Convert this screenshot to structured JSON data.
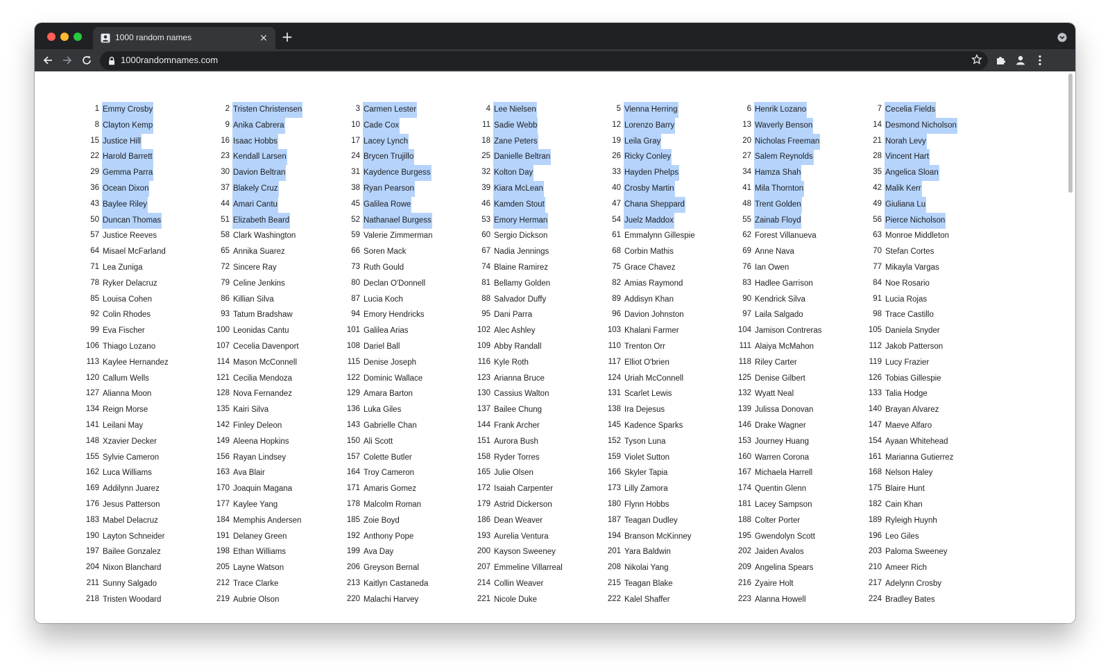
{
  "browser": {
    "tab_title": "1000 random names",
    "tab_close": "×",
    "new_tab": "+",
    "url": "1000randomnames.com",
    "icons": [
      "back-arrow-icon",
      "forward-arrow-icon",
      "reload-icon",
      "lock-icon",
      "bookmark-star-icon",
      "extensions-puzzle-icon",
      "profile-icon",
      "kebab-menu-icon",
      "tab-search-icon"
    ]
  },
  "colors": {
    "selection": "#b6d4fb",
    "chrome_dark": "#202124",
    "chrome_toolbar": "#35363a"
  },
  "selected_through": 56,
  "names": [
    "Emmy Crosby",
    "Tristen Christensen",
    "Carmen Lester",
    "Lee Nielsen",
    "Vienna Herring",
    "Henrik Lozano",
    "Cecelia Fields",
    "Clayton Kemp",
    "Anika Cabrera",
    "Cade Cox",
    "Sadie Webb",
    "Lorenzo Barry",
    "Waverly Benson",
    "Desmond Nicholson",
    "Justice Hill",
    "Isaac Hobbs",
    "Lacey Lynch",
    "Zane Peters",
    "Leila Gray",
    "Nicholas Freeman",
    "Norah Levy",
    "Harold Barrett",
    "Kendall Larsen",
    "Brycen Trujillo",
    "Danielle Beltran",
    "Ricky Conley",
    "Salem Reynolds",
    "Vincent Hart",
    "Gemma Parra",
    "Davion Beltran",
    "Kaydence Burgess",
    "Kolton Day",
    "Hayden Phelps",
    "Hamza Shah",
    "Angelica Sloan",
    "Ocean Dixon",
    "Blakely Cruz",
    "Ryan Pearson",
    "Kiara McLean",
    "Crosby Martin",
    "Mila Thornton",
    "Malik Kerr",
    "Baylee Riley",
    "Amari Cantu",
    "Galilea Rowe",
    "Kamden Stout",
    "Chana Sheppard",
    "Trent Golden",
    "Giuliana Lu",
    "Duncan Thomas",
    "Elizabeth Beard",
    "Nathanael Burgess",
    "Emory Herman",
    "Juelz Maddox",
    "Zainab Floyd",
    "Pierce Nicholson",
    "Justice Reeves",
    "Clark Washington",
    "Valerie Zimmerman",
    "Sergio Dickson",
    "Emmalynn Gillespie",
    "Forest Villanueva",
    "Monroe Middleton",
    "Misael McFarland",
    "Annika Suarez",
    "Soren Mack",
    "Nadia Jennings",
    "Corbin Mathis",
    "Anne Nava",
    "Stefan Cortes",
    "Lea Zuniga",
    "Sincere Ray",
    "Ruth Gould",
    "Blaine Ramirez",
    "Grace Chavez",
    "Ian Owen",
    "Mikayla Vargas",
    "Ryker Delacruz",
    "Celine Jenkins",
    "Declan O'Donnell",
    "Bellamy Golden",
    "Amias Raymond",
    "Hadlee Garrison",
    "Noe Rosario",
    "Louisa Cohen",
    "Killian Silva",
    "Lucia Koch",
    "Salvador Duffy",
    "Addisyn Khan",
    "Kendrick Silva",
    "Lucia Rojas",
    "Colin Rhodes",
    "Tatum Bradshaw",
    "Emory Hendricks",
    "Dani Parra",
    "Davion Johnston",
    "Laila Salgado",
    "Trace Castillo",
    "Eva Fischer",
    "Leonidas Cantu",
    "Galilea Arias",
    "Alec Ashley",
    "Khalani Farmer",
    "Jamison Contreras",
    "Daniela Snyder",
    "Thiago Lozano",
    "Cecelia Davenport",
    "Dariel Ball",
    "Abby Randall",
    "Trenton Orr",
    "Alaiya McMahon",
    "Jakob Patterson",
    "Kaylee Hernandez",
    "Mason McConnell",
    "Denise Joseph",
    "Kyle Roth",
    "Elliot O'brien",
    "Riley Carter",
    "Lucy Frazier",
    "Callum Wells",
    "Cecilia Mendoza",
    "Dominic Wallace",
    "Arianna Bruce",
    "Uriah McConnell",
    "Denise Gilbert",
    "Tobias Gillespie",
    "Alianna Moon",
    "Nova Fernandez",
    "Amara Barton",
    "Cassius Walton",
    "Scarlet Lewis",
    "Wyatt Neal",
    "Talia Hodge",
    "Reign Morse",
    "Kairi Silva",
    "Luka Giles",
    "Bailee Chung",
    "Ira Dejesus",
    "Julissa Donovan",
    "Brayan Alvarez",
    "Leilani May",
    "Finley Deleon",
    "Gabrielle Chan",
    "Frank Archer",
    "Kadence Sparks",
    "Drake Wagner",
    "Maeve Alfaro",
    "Xzavier Decker",
    "Aleena Hopkins",
    "Ali Scott",
    "Aurora Bush",
    "Tyson Luna",
    "Journey Huang",
    "Ayaan Whitehead",
    "Sylvie Cameron",
    "Rayan Lindsey",
    "Colette Butler",
    "Ryder Torres",
    "Violet Sutton",
    "Warren Corona",
    "Marianna Gutierrez",
    "Luca Williams",
    "Ava Blair",
    "Troy Cameron",
    "Julie Olsen",
    "Skyler Tapia",
    "Michaela Harrell",
    "Nelson Haley",
    "Addilynn Juarez",
    "Joaquin Magana",
    "Amaris Gomez",
    "Isaiah Carpenter",
    "Lilly Zamora",
    "Quentin Glenn",
    "Blaire Hunt",
    "Jesus Patterson",
    "Kaylee Yang",
    "Malcolm Roman",
    "Astrid Dickerson",
    "Flynn Hobbs",
    "Lacey Sampson",
    "Cain Khan",
    "Mabel Delacruz",
    "Memphis Andersen",
    "Zoie Boyd",
    "Dean Weaver",
    "Teagan Dudley",
    "Colter Porter",
    "Ryleigh Huynh",
    "Layton Schneider",
    "Delaney Green",
    "Anthony Pope",
    "Aurelia Ventura",
    "Branson McKinney",
    "Gwendolyn Scott",
    "Leo Giles",
    "Bailee Gonzalez",
    "Ethan Williams",
    "Ava Day",
    "Kayson Sweeney",
    "Yara Baldwin",
    "Jaiden Avalos",
    "Paloma Sweeney",
    "Nixon Blanchard",
    "Layne Watson",
    "Greyson Bernal",
    "Emmeline Villarreal",
    "Nikolai Yang",
    "Angelina Spears",
    "Ameer Rich",
    "Sunny Salgado",
    "Trace Clarke",
    "Kaitlyn Castaneda",
    "Collin Weaver",
    "Teagan Blake",
    "Zyaire Holt",
    "Adelynn Crosby",
    "Tristen Woodard",
    "Aubrie Olson",
    "Malachi Harvey",
    "Nicole Duke",
    "Kalel Shaffer",
    "Alanna Howell",
    "Bradley Bates"
  ]
}
